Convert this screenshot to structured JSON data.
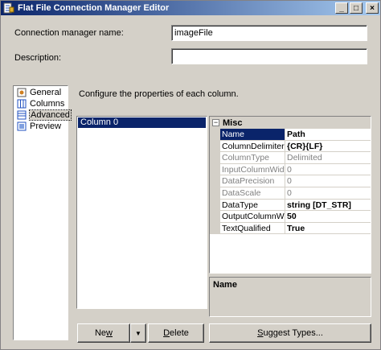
{
  "window": {
    "title": "Flat File Connection Manager Editor",
    "minimize_glyph": "_",
    "maximize_glyph": "□",
    "close_glyph": "×"
  },
  "connection_name": {
    "label": "Connection manager name:",
    "value": "imageFile"
  },
  "description": {
    "label": "Description:",
    "value": ""
  },
  "nav": {
    "items": [
      {
        "label": "General",
        "icon": "general-icon",
        "selected": false
      },
      {
        "label": "Columns",
        "icon": "columns-icon",
        "selected": false
      },
      {
        "label": "Advanced",
        "icon": "advanced-icon",
        "selected": true
      },
      {
        "label": "Preview",
        "icon": "preview-icon",
        "selected": false
      }
    ]
  },
  "main": {
    "instruction": "Configure the properties of each column.",
    "columns": [
      "Column 0"
    ]
  },
  "properties": {
    "category": "Misc",
    "toggle_glyph": "−",
    "rows": [
      {
        "name": "Name",
        "value": "Path",
        "selected": true,
        "readonly": false,
        "bold": true
      },
      {
        "name": "ColumnDelimiter",
        "value": "{CR}{LF}",
        "selected": false,
        "readonly": false,
        "bold": true
      },
      {
        "name": "ColumnType",
        "value": "Delimited",
        "selected": false,
        "readonly": true,
        "bold": false
      },
      {
        "name": "InputColumnWidth",
        "value": "0",
        "selected": false,
        "readonly": true,
        "bold": false
      },
      {
        "name": "DataPrecision",
        "value": "0",
        "selected": false,
        "readonly": true,
        "bold": false
      },
      {
        "name": "DataScale",
        "value": "0",
        "selected": false,
        "readonly": true,
        "bold": false
      },
      {
        "name": "DataType",
        "value": "string [DT_STR]",
        "selected": false,
        "readonly": false,
        "bold": true
      },
      {
        "name": "OutputColumnWidth",
        "value": "50",
        "selected": false,
        "readonly": false,
        "bold": true
      },
      {
        "name": "TextQualified",
        "value": "True",
        "selected": false,
        "readonly": false,
        "bold": true
      }
    ],
    "description_title": "Name"
  },
  "buttons": {
    "new_label_pre": "Ne",
    "new_label_u": "w",
    "new_dropdown": "▼",
    "delete_label_pre": "",
    "delete_label_u": "D",
    "delete_label_post": "elete",
    "suggest_label_pre": "",
    "suggest_label_u": "S",
    "suggest_label_post": "uggest Types..."
  },
  "colors": {
    "titlebar_start": "#0a246a",
    "titlebar_end": "#a6caf0",
    "selection": "#0a246a",
    "face": "#d4d0c8"
  }
}
